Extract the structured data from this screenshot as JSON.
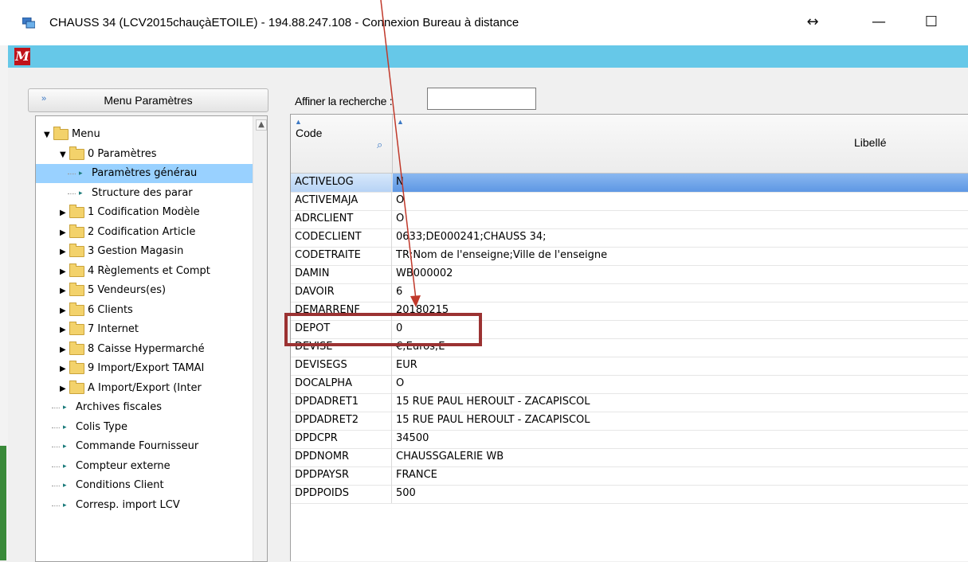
{
  "window": {
    "title": "CHAUSS 34 (LCV2015chauçàETOILE) - 194.88.247.108 - Connexion Bureau à distance",
    "buttons": {
      "resize": "↔",
      "minimize": "—",
      "maximize": "☐"
    }
  },
  "app": {
    "logo": "M"
  },
  "menu_button": {
    "chevron": "»",
    "label": "Menu Paramètres"
  },
  "search": {
    "label": "Affiner la recherche :",
    "value": ""
  },
  "tree": {
    "items": [
      {
        "label": "Menu",
        "kind": "folder",
        "expanded": true
      },
      {
        "label": "0 Paramètres",
        "kind": "folder",
        "expanded": true
      },
      {
        "label": "Paramètres générau",
        "kind": "leaf",
        "selected": true
      },
      {
        "label": "Structure des parar",
        "kind": "leaf"
      },
      {
        "label": "1 Codification Modèle",
        "kind": "folder"
      },
      {
        "label": "2 Codification Article",
        "kind": "folder"
      },
      {
        "label": "3 Gestion Magasin",
        "kind": "folder"
      },
      {
        "label": "4 Règlements et Compt",
        "kind": "folder"
      },
      {
        "label": "5 Vendeurs(es)",
        "kind": "folder"
      },
      {
        "label": "6 Clients",
        "kind": "folder"
      },
      {
        "label": "7 Internet",
        "kind": "folder"
      },
      {
        "label": "8 Caisse Hypermarché",
        "kind": "folder"
      },
      {
        "label": "9 Import/Export TAMAI",
        "kind": "folder"
      },
      {
        "label": "A Import/Export (Inter",
        "kind": "folder"
      },
      {
        "label": "Archives fiscales",
        "kind": "leaf"
      },
      {
        "label": "Colis Type",
        "kind": "leaf"
      },
      {
        "label": "Commande Fournisseur",
        "kind": "leaf"
      },
      {
        "label": "Compteur externe",
        "kind": "leaf"
      },
      {
        "label": "Conditions Client",
        "kind": "leaf"
      },
      {
        "label": "Corresp. import LCV",
        "kind": "leaf"
      }
    ]
  },
  "grid": {
    "headers": {
      "code": "Code",
      "libelle": "Libellé"
    },
    "rows": [
      {
        "code": "ACTIVELOG",
        "value": "N",
        "selected": true
      },
      {
        "code": "ACTIVEMAJA",
        "value": "O"
      },
      {
        "code": "ADRCLIENT",
        "value": "O"
      },
      {
        "code": "CODECLIENT",
        "value": "0633;DE000241;CHAUSS 34;"
      },
      {
        "code": "CODETRAITE",
        "value": "TR;Nom de l'enseigne;Ville de l'enseigne"
      },
      {
        "code": "DAMIN",
        "value": "WB000002"
      },
      {
        "code": "DAVOIR",
        "value": "6"
      },
      {
        "code": "DEMARRENF",
        "value": "20180215"
      },
      {
        "code": "DEPOT",
        "value": "0"
      },
      {
        "code": "DEVISE",
        "value": "€;Euros;E"
      },
      {
        "code": "DEVISEGS",
        "value": "EUR"
      },
      {
        "code": "DOCALPHA",
        "value": "O"
      },
      {
        "code": "DPDADRET1",
        "value": "15 RUE PAUL HEROULT - ZACAPISCOL"
      },
      {
        "code": "DPDADRET2",
        "value": "15 RUE PAUL HEROULT - ZACAPISCOL"
      },
      {
        "code": "DPDCPR",
        "value": "34500"
      },
      {
        "code": "DPDNOMR",
        "value": "CHAUSSGALERIE WB"
      },
      {
        "code": "DPDPAYSR",
        "value": "FRANCE"
      },
      {
        "code": "DPDPOIDS",
        "value": "500"
      }
    ]
  },
  "annotation": {
    "highlighted_row": "DEMARRENF",
    "color": "#9b3232",
    "arrow_color": "#c0392b"
  }
}
